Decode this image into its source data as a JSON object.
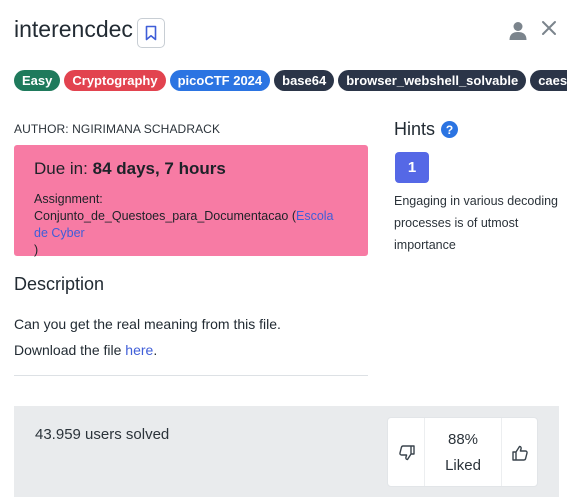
{
  "challenge": {
    "title": "interencdec"
  },
  "header": {
    "bookmark_icon": "bookmark-icon",
    "user_icon": "user-icon",
    "close_icon": "close-icon"
  },
  "tags": [
    "Easy",
    "Cryptography",
    "picoCTF 2024",
    "base64",
    "browser_webshell_solvable",
    "caesar"
  ],
  "author": "AUTHOR: NGIRIMANA SCHADRACK",
  "due": {
    "prefix": "Due in:",
    "value": "84 days, 7 hours",
    "assignment_label": "Assignment:",
    "assignment_name": "Conjunto_de_Questoes_para_Documentacao (",
    "assignment_link": "Escola de Cyber",
    "assignment_suffix": ")",
    "background": "#f77ba4"
  },
  "description": {
    "heading": "Description",
    "line1": "Can you get the real meaning from this file.",
    "line2_prefix": "Download the file ",
    "line2_link": "here",
    "line2_suffix": "."
  },
  "hints": {
    "heading": "Hints",
    "help_glyph": "?",
    "items": [
      {
        "number": "1",
        "text": "Engaging in various decoding processes is of utmost importance"
      }
    ]
  },
  "stats": {
    "solved": "43.959 users solved",
    "liked_percent": "88%",
    "liked_label": "Liked"
  },
  "colors": {
    "accent": "#5568e6",
    "link": "#3f5ed8",
    "easy": "#1f7a5c",
    "crypto": "#e2434f",
    "pico": "#2b74e2",
    "dark_tag": "#2b3548"
  }
}
